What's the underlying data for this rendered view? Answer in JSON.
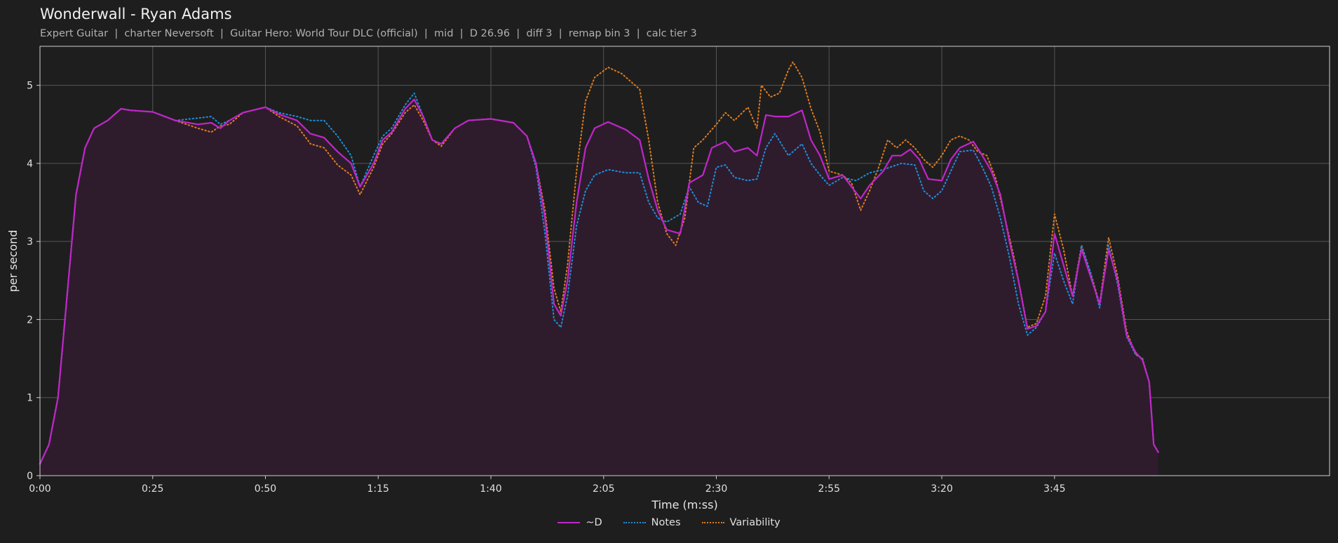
{
  "title": "Wonderwall - Ryan Adams",
  "subtitle": "Expert Guitar  |  charter Neversoft  |  Guitar Hero: World Tour DLC (official)  |  mid  |  D 26.96  |  diff 3  |  remap bin 3  |  calc tier 3",
  "chart_data": {
    "type": "line",
    "xlabel": "Time (m:ss)",
    "ylabel": "per second",
    "xlim": [
      0,
      286
    ],
    "ylim": [
      0,
      5.5
    ],
    "x_ticks": [
      0,
      25,
      50,
      75,
      100,
      125,
      150,
      175,
      200,
      225
    ],
    "x_tick_labels": [
      "0:00",
      "0:25",
      "0:50",
      "1:15",
      "1:40",
      "2:05",
      "2:30",
      "2:55",
      "3:20",
      "3:45"
    ],
    "y_ticks": [
      0,
      1,
      2,
      3,
      4,
      5
    ],
    "y_tick_labels": [
      "0",
      "1",
      "2",
      "3",
      "4",
      "5"
    ],
    "grid": true,
    "legend_position": "bottom-center",
    "series": [
      {
        "name": "~D",
        "color": "#c026c9",
        "style": "solid",
        "points": [
          [
            0,
            0.15
          ],
          [
            2,
            0.4
          ],
          [
            4,
            1.0
          ],
          [
            6,
            2.3
          ],
          [
            8,
            3.6
          ],
          [
            10,
            4.2
          ],
          [
            12,
            4.45
          ],
          [
            15,
            4.55
          ],
          [
            18,
            4.7
          ],
          [
            20,
            4.68
          ],
          [
            25,
            4.66
          ],
          [
            30,
            4.55
          ],
          [
            35,
            4.5
          ],
          [
            38,
            4.52
          ],
          [
            40,
            4.45
          ],
          [
            42,
            4.55
          ],
          [
            45,
            4.65
          ],
          [
            50,
            4.72
          ],
          [
            53,
            4.63
          ],
          [
            57,
            4.55
          ],
          [
            60,
            4.38
          ],
          [
            63,
            4.33
          ],
          [
            66,
            4.15
          ],
          [
            69,
            4.0
          ],
          [
            71,
            3.7
          ],
          [
            74,
            4.0
          ],
          [
            76,
            4.3
          ],
          [
            78,
            4.4
          ],
          [
            81,
            4.7
          ],
          [
            83,
            4.82
          ],
          [
            85,
            4.6
          ],
          [
            87,
            4.3
          ],
          [
            89,
            4.25
          ],
          [
            92,
            4.45
          ],
          [
            95,
            4.55
          ],
          [
            100,
            4.57
          ],
          [
            105,
            4.52
          ],
          [
            108,
            4.35
          ],
          [
            110,
            4.0
          ],
          [
            112,
            3.3
          ],
          [
            114,
            2.2
          ],
          [
            115.5,
            2.05
          ],
          [
            117,
            2.5
          ],
          [
            119,
            3.5
          ],
          [
            121,
            4.2
          ],
          [
            123,
            4.45
          ],
          [
            126,
            4.53
          ],
          [
            130,
            4.43
          ],
          [
            133,
            4.3
          ],
          [
            135,
            3.8
          ],
          [
            137,
            3.4
          ],
          [
            139,
            3.15
          ],
          [
            142,
            3.1
          ],
          [
            144,
            3.75
          ],
          [
            147,
            3.85
          ],
          [
            149,
            4.2
          ],
          [
            152,
            4.28
          ],
          [
            154,
            4.15
          ],
          [
            157,
            4.2
          ],
          [
            159,
            4.1
          ],
          [
            161,
            4.62
          ],
          [
            163,
            4.6
          ],
          [
            166,
            4.6
          ],
          [
            169,
            4.68
          ],
          [
            171,
            4.3
          ],
          [
            173,
            4.1
          ],
          [
            175,
            3.8
          ],
          [
            178,
            3.85
          ],
          [
            180,
            3.7
          ],
          [
            182,
            3.55
          ],
          [
            184,
            3.72
          ],
          [
            187,
            3.9
          ],
          [
            189,
            4.1
          ],
          [
            191,
            4.1
          ],
          [
            193,
            4.18
          ],
          [
            195,
            4.05
          ],
          [
            197,
            3.8
          ],
          [
            200,
            3.78
          ],
          [
            202,
            4.05
          ],
          [
            204,
            4.2
          ],
          [
            207,
            4.28
          ],
          [
            209,
            4.1
          ],
          [
            211,
            3.9
          ],
          [
            213,
            3.6
          ],
          [
            215,
            3.0
          ],
          [
            217,
            2.5
          ],
          [
            219,
            1.88
          ],
          [
            221,
            1.92
          ],
          [
            223,
            2.1
          ],
          [
            225,
            3.1
          ],
          [
            227,
            2.7
          ],
          [
            229,
            2.3
          ],
          [
            231,
            2.9
          ],
          [
            233,
            2.55
          ],
          [
            235,
            2.2
          ],
          [
            237,
            2.9
          ],
          [
            239,
            2.5
          ],
          [
            241,
            1.8
          ],
          [
            243,
            1.58
          ],
          [
            244.5,
            1.48
          ],
          [
            246,
            1.2
          ],
          [
            247,
            0.4
          ],
          [
            248,
            0.3
          ]
        ]
      },
      {
        "name": "Notes",
        "color": "#1f8ed8",
        "style": "dotted",
        "points": [
          [
            0,
            0.15
          ],
          [
            2,
            0.4
          ],
          [
            4,
            1.0
          ],
          [
            6,
            2.3
          ],
          [
            8,
            3.6
          ],
          [
            10,
            4.2
          ],
          [
            12,
            4.45
          ],
          [
            15,
            4.55
          ],
          [
            18,
            4.7
          ],
          [
            20,
            4.68
          ],
          [
            25,
            4.66
          ],
          [
            30,
            4.55
          ],
          [
            35,
            4.58
          ],
          [
            38,
            4.6
          ],
          [
            40,
            4.5
          ],
          [
            42,
            4.55
          ],
          [
            45,
            4.65
          ],
          [
            50,
            4.72
          ],
          [
            53,
            4.65
          ],
          [
            57,
            4.6
          ],
          [
            60,
            4.55
          ],
          [
            63,
            4.55
          ],
          [
            66,
            4.35
          ],
          [
            69,
            4.1
          ],
          [
            71,
            3.7
          ],
          [
            74,
            4.1
          ],
          [
            76,
            4.35
          ],
          [
            78,
            4.45
          ],
          [
            81,
            4.75
          ],
          [
            83,
            4.9
          ],
          [
            85,
            4.6
          ],
          [
            87,
            4.3
          ],
          [
            89,
            4.25
          ],
          [
            92,
            4.45
          ],
          [
            95,
            4.55
          ],
          [
            100,
            4.57
          ],
          [
            105,
            4.52
          ],
          [
            108,
            4.35
          ],
          [
            110,
            3.95
          ],
          [
            112,
            3.1
          ],
          [
            114,
            2.0
          ],
          [
            115.5,
            1.9
          ],
          [
            117,
            2.3
          ],
          [
            119,
            3.2
          ],
          [
            121,
            3.65
          ],
          [
            123,
            3.85
          ],
          [
            126,
            3.92
          ],
          [
            130,
            3.88
          ],
          [
            133,
            3.88
          ],
          [
            135,
            3.5
          ],
          [
            137,
            3.3
          ],
          [
            139,
            3.25
          ],
          [
            142,
            3.35
          ],
          [
            144,
            3.7
          ],
          [
            146,
            3.5
          ],
          [
            148,
            3.45
          ],
          [
            150,
            3.95
          ],
          [
            152,
            3.98
          ],
          [
            154,
            3.82
          ],
          [
            157,
            3.78
          ],
          [
            159,
            3.8
          ],
          [
            161,
            4.2
          ],
          [
            163,
            4.38
          ],
          [
            166,
            4.1
          ],
          [
            169,
            4.25
          ],
          [
            171,
            4.0
          ],
          [
            173,
            3.85
          ],
          [
            175,
            3.72
          ],
          [
            178,
            3.82
          ],
          [
            181,
            3.78
          ],
          [
            184,
            3.88
          ],
          [
            187,
            3.92
          ],
          [
            191,
            4.0
          ],
          [
            194,
            3.98
          ],
          [
            196,
            3.65
          ],
          [
            198,
            3.55
          ],
          [
            200,
            3.65
          ],
          [
            202,
            3.9
          ],
          [
            204,
            4.15
          ],
          [
            207,
            4.17
          ],
          [
            209,
            3.95
          ],
          [
            211,
            3.7
          ],
          [
            213,
            3.3
          ],
          [
            215,
            2.8
          ],
          [
            217,
            2.2
          ],
          [
            219,
            1.8
          ],
          [
            221,
            1.9
          ],
          [
            223,
            2.1
          ],
          [
            225,
            2.85
          ],
          [
            227,
            2.5
          ],
          [
            229,
            2.2
          ],
          [
            231,
            2.95
          ],
          [
            233,
            2.6
          ],
          [
            235,
            2.15
          ],
          [
            237,
            2.95
          ],
          [
            239,
            2.45
          ],
          [
            241,
            1.78
          ],
          [
            243,
            1.55
          ],
          [
            244.5,
            1.5
          ],
          [
            246,
            1.2
          ],
          [
            247,
            0.4
          ],
          [
            248,
            0.3
          ]
        ]
      },
      {
        "name": "Variability",
        "color": "#e07b1f",
        "style": "dotted",
        "points": [
          [
            0,
            0.15
          ],
          [
            2,
            0.4
          ],
          [
            4,
            1.0
          ],
          [
            6,
            2.3
          ],
          [
            8,
            3.6
          ],
          [
            10,
            4.2
          ],
          [
            12,
            4.45
          ],
          [
            15,
            4.55
          ],
          [
            18,
            4.7
          ],
          [
            20,
            4.68
          ],
          [
            25,
            4.66
          ],
          [
            30,
            4.55
          ],
          [
            35,
            4.45
          ],
          [
            38,
            4.4
          ],
          [
            40,
            4.48
          ],
          [
            42,
            4.5
          ],
          [
            45,
            4.65
          ],
          [
            50,
            4.72
          ],
          [
            53,
            4.6
          ],
          [
            57,
            4.48
          ],
          [
            60,
            4.25
          ],
          [
            63,
            4.2
          ],
          [
            66,
            3.98
          ],
          [
            69,
            3.85
          ],
          [
            71,
            3.6
          ],
          [
            74,
            3.95
          ],
          [
            76,
            4.25
          ],
          [
            78,
            4.38
          ],
          [
            81,
            4.65
          ],
          [
            83,
            4.75
          ],
          [
            85,
            4.55
          ],
          [
            87,
            4.3
          ],
          [
            89,
            4.22
          ],
          [
            92,
            4.45
          ],
          [
            95,
            4.55
          ],
          [
            100,
            4.57
          ],
          [
            105,
            4.52
          ],
          [
            108,
            4.35
          ],
          [
            110,
            4.0
          ],
          [
            112,
            3.4
          ],
          [
            114,
            2.4
          ],
          [
            115.5,
            2.1
          ],
          [
            117,
            2.7
          ],
          [
            119,
            3.9
          ],
          [
            121,
            4.8
          ],
          [
            123,
            5.1
          ],
          [
            126,
            5.23
          ],
          [
            129,
            5.15
          ],
          [
            131,
            5.05
          ],
          [
            133,
            4.95
          ],
          [
            135,
            4.3
          ],
          [
            137,
            3.5
          ],
          [
            139,
            3.1
          ],
          [
            141,
            2.95
          ],
          [
            143,
            3.3
          ],
          [
            145,
            4.2
          ],
          [
            147,
            4.3
          ],
          [
            150,
            4.5
          ],
          [
            152,
            4.65
          ],
          [
            154,
            4.55
          ],
          [
            157,
            4.72
          ],
          [
            159,
            4.45
          ],
          [
            160,
            5.0
          ],
          [
            162,
            4.85
          ],
          [
            164,
            4.9
          ],
          [
            166,
            5.2
          ],
          [
            167,
            5.3
          ],
          [
            169,
            5.1
          ],
          [
            171,
            4.7
          ],
          [
            173,
            4.4
          ],
          [
            175,
            3.9
          ],
          [
            178,
            3.85
          ],
          [
            180,
            3.75
          ],
          [
            182,
            3.4
          ],
          [
            184,
            3.65
          ],
          [
            186,
            3.95
          ],
          [
            188,
            4.3
          ],
          [
            190,
            4.2
          ],
          [
            192,
            4.3
          ],
          [
            194,
            4.2
          ],
          [
            196,
            4.05
          ],
          [
            198,
            3.95
          ],
          [
            200,
            4.1
          ],
          [
            202,
            4.3
          ],
          [
            204,
            4.35
          ],
          [
            206,
            4.3
          ],
          [
            208,
            4.15
          ],
          [
            210,
            4.1
          ],
          [
            212,
            3.8
          ],
          [
            214,
            3.3
          ],
          [
            216,
            2.8
          ],
          [
            218,
            2.2
          ],
          [
            219,
            1.9
          ],
          [
            221,
            1.95
          ],
          [
            223,
            2.3
          ],
          [
            225,
            3.35
          ],
          [
            227,
            2.9
          ],
          [
            229,
            2.3
          ],
          [
            231,
            2.95
          ],
          [
            233,
            2.6
          ],
          [
            235,
            2.2
          ],
          [
            237,
            3.05
          ],
          [
            239,
            2.55
          ],
          [
            241,
            1.85
          ],
          [
            243,
            1.55
          ],
          [
            244.5,
            1.5
          ],
          [
            246,
            1.2
          ],
          [
            247,
            0.4
          ],
          [
            248,
            0.3
          ]
        ]
      }
    ]
  }
}
